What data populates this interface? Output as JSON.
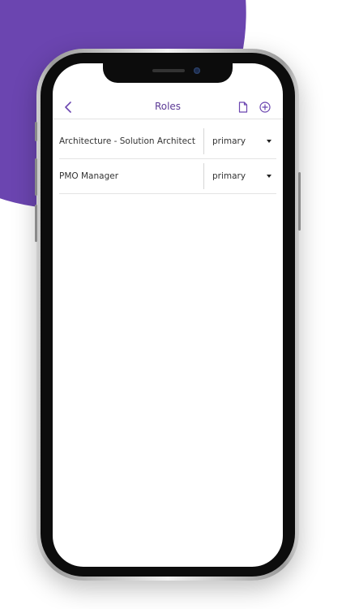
{
  "nav": {
    "title": "Roles",
    "back_icon": "chevron-left-icon",
    "document_icon": "document-icon",
    "add_icon": "plus-circle-icon"
  },
  "roles": [
    {
      "name": "Architecture - Solution Architect",
      "type": "primary"
    },
    {
      "name": "PMO Manager",
      "type": "primary"
    }
  ],
  "colors": {
    "accent": "#6b45b0",
    "title": "#5c3a96"
  }
}
